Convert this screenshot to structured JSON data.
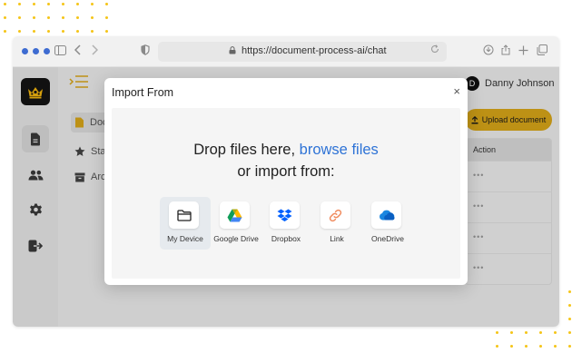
{
  "browser": {
    "url": "https://document-process-ai/chat",
    "traffic_colors": [
      "#3d6bd1",
      "#3d6bd1",
      "#3d6bd1"
    ]
  },
  "header": {
    "user_initial": "D",
    "user_name": "Danny Johnson",
    "upload_label": "Upload document"
  },
  "nav": {
    "items": [
      {
        "label": "Doc",
        "icon": "document-icon",
        "active": true
      },
      {
        "label": "Star",
        "icon": "star-icon",
        "active": false
      },
      {
        "label": "Arch",
        "icon": "archive-icon",
        "active": false
      }
    ]
  },
  "sidebar": {
    "icons": [
      "document-icon",
      "users-icon",
      "gear-icon",
      "logout-icon"
    ]
  },
  "table": {
    "header": "Action",
    "rows": [
      "•••",
      "•••",
      "•••",
      "•••"
    ]
  },
  "modal": {
    "title": "Import From",
    "close": "×",
    "drop_text": "Drop files here,",
    "browse_text": "browse files",
    "import_text": "or import from:",
    "sources": [
      {
        "label": "My Device",
        "icon": "folder-icon"
      },
      {
        "label": "Google Drive",
        "icon": "google-drive-icon"
      },
      {
        "label": "Dropbox",
        "icon": "dropbox-icon"
      },
      {
        "label": "Link",
        "icon": "link-icon"
      },
      {
        "label": "OneDrive",
        "icon": "onedrive-icon"
      }
    ]
  },
  "colors": {
    "accent": "#d8a518",
    "link": "#2e73d6",
    "dots": "#f5c518"
  }
}
